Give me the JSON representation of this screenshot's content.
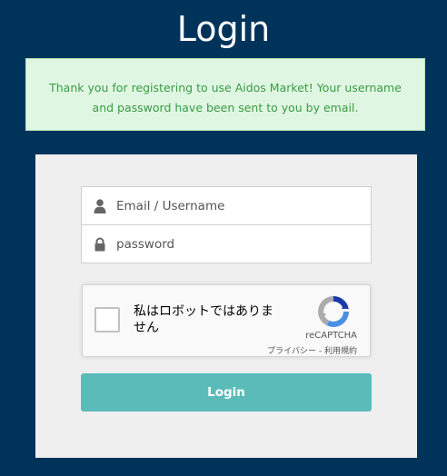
{
  "page": {
    "title": "Login"
  },
  "alert": {
    "message": "Thank you for registering to use Aidos Market! Your username and password have been sent to you by email."
  },
  "form": {
    "username_placeholder": "Email / Username",
    "password_placeholder": "password",
    "submit_label": "Login",
    "username_icon": "user-icon",
    "password_icon": "lock-icon"
  },
  "recaptcha": {
    "checkbox_label": "私はロボットではありません",
    "brand": "reCAPTCHA",
    "privacy_link": "プライバシー",
    "separator": " - ",
    "terms_link": "利用規約"
  },
  "colors": {
    "background": "#00335a",
    "alert_bg": "#dff7e2",
    "alert_text": "#3b9a44",
    "panel_bg": "#efefef",
    "button": "#5bbbb8"
  }
}
